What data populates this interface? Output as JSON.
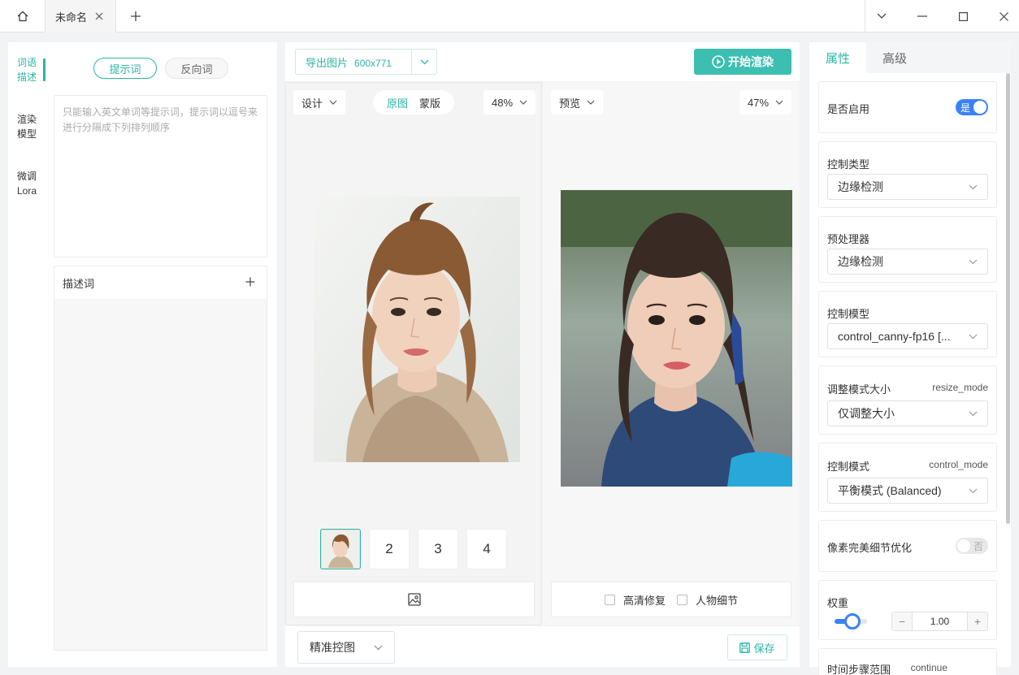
{
  "titlebar": {
    "tab_title": "未命名"
  },
  "left": {
    "vtabs": [
      {
        "line1": "词语",
        "line2": "描述",
        "active": true
      },
      {
        "line1": "渲染",
        "line2": "模型",
        "active": false
      },
      {
        "line1": "微调",
        "line2": "Lora",
        "active": false
      }
    ],
    "prompt_tab": "提示词",
    "negative_tab": "反向词",
    "prompt_placeholder": "只能输入英文单词等提示词，提示词以逗号来进行分隔成下列排列顺序",
    "desc_title": "描述词"
  },
  "center": {
    "export_label": "导出图片",
    "export_size": "600x771",
    "render_label": "开始渲染",
    "design_label": "设计",
    "seg_original": "原图",
    "seg_mask": "蒙版",
    "zoom_left": "48%",
    "preview_label": "预览",
    "zoom_right": "47%",
    "thumbs": [
      "2",
      "3",
      "4"
    ],
    "hd_fix": "高清修复",
    "person_detail": "人物细节",
    "mode_select": "精准控图",
    "save_label": "保存"
  },
  "right": {
    "tab_props": "属性",
    "tab_advanced": "高级",
    "enable_label": "是否启用",
    "enable_value": "是",
    "control_type_label": "控制类型",
    "control_type_value": "边缘检测",
    "preprocessor_label": "预处理器",
    "preprocessor_value": "边缘检测",
    "control_model_label": "控制模型",
    "control_model_value": "control_canny-fp16 [...",
    "resize_label": "调整模式大小",
    "resize_key": "resize_mode",
    "resize_value": "仅调整大小",
    "control_mode_label": "控制模式",
    "control_mode_key": "control_mode",
    "control_mode_value": "平衡模式 (Balanced)",
    "pixel_perfect_label": "像素完美细节优化",
    "pixel_perfect_value": "否",
    "weight_label": "权重",
    "weight_value": "1.00",
    "weight_level": 0.55,
    "next_label": "时间步骤范围",
    "next_key": "continue"
  },
  "colors": {
    "accent": "#2bb5a6",
    "toggle_on": "#3b82f6"
  }
}
